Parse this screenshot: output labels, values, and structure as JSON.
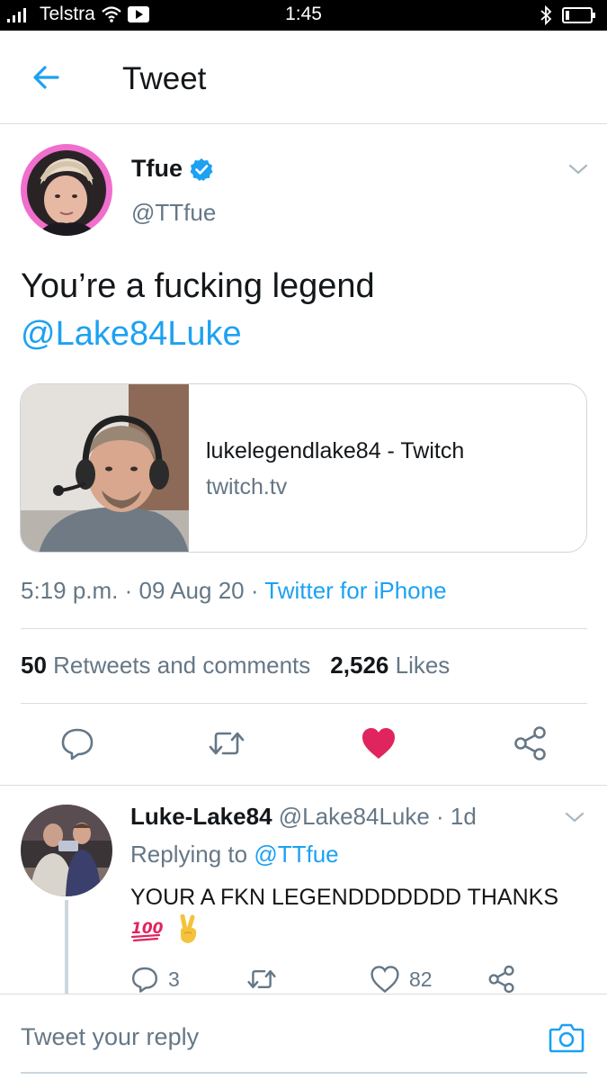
{
  "status_bar": {
    "carrier": "Telstra",
    "time": "1:45"
  },
  "header": {
    "title": "Tweet"
  },
  "tweet": {
    "author_name": "Tfue",
    "author_handle": "@TTfue",
    "text": "You’re a fucking legend",
    "mention": "@Lake84Luke",
    "card": {
      "title": "lukelegendlake84 - Twitch",
      "domain": "twitch.tv"
    },
    "timestamp": "5:19 p.m. · 09 Aug 20 · ",
    "source": "Twitter for iPhone",
    "retweets_count": "50",
    "retweets_label": "Retweets and comments",
    "likes_count": "2,526",
    "likes_label": "Likes",
    "liked": true
  },
  "reply": {
    "author_name": "Luke-Lake84",
    "meta": " @Lake84Luke · 1d",
    "replying_prefix": "Replying to ",
    "replying_to": "@TTfue",
    "text": "YOUR A FKN LEGENDDDDDDD THANKS",
    "comments_count": "3",
    "likes_count": "82"
  },
  "composer": {
    "placeholder": "Tweet your reply"
  },
  "colors": {
    "accent": "#1da1f2",
    "like": "#e0245e",
    "muted": "#657786"
  },
  "icons": {
    "back": "arrow-left-icon",
    "verified": "verified-badge-icon",
    "reply": "comment-icon",
    "retweet": "retweet-icon",
    "like": "heart-icon",
    "share": "share-icon",
    "camera": "camera-icon"
  }
}
